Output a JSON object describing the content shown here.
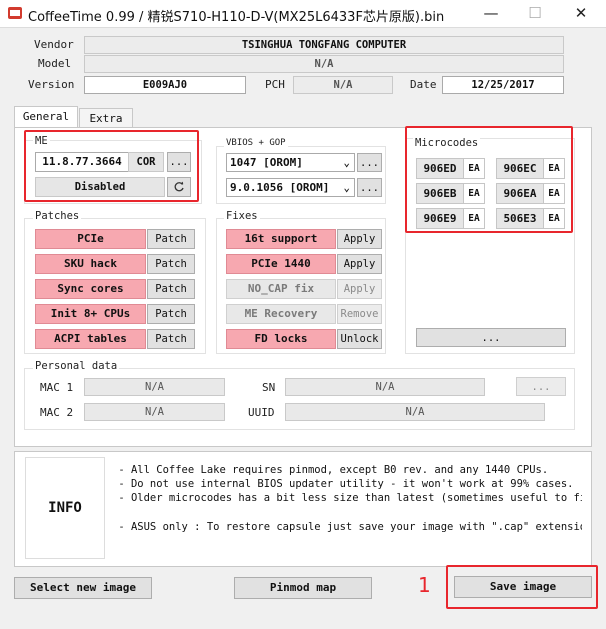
{
  "window": {
    "title": "CoffeeTime 0.99  /  精锐S710-H110-D-V(MX25L6433F芯片原版).bin",
    "minimize": "—",
    "maximize": "☐",
    "close": "✕"
  },
  "header": {
    "vendor_label": "Vendor",
    "vendor_value": "TSINGHUA TONGFANG COMPUTER",
    "model_label": "Model",
    "model_value": "N/A",
    "version_label": "Version",
    "version_value": "E009AJ0",
    "pch_label": "PCH",
    "pch_value": "N/A",
    "date_label": "Date",
    "date_value": "12/25/2017"
  },
  "tabs": [
    "General",
    "Extra"
  ],
  "me": {
    "title": "ME",
    "version": "11.8.77.3664",
    "type": "COR",
    "more": "...",
    "state": "Disabled",
    "refresh_icon": "refresh-icon"
  },
  "vbios": {
    "title": "VBIOS + GOP",
    "vbios_value": "1047 [OROM]",
    "gop_value": "9.0.1056 [OROM]",
    "more": "..."
  },
  "microcodes": {
    "title": "Microcodes",
    "items": [
      {
        "code": "906ED",
        "btn": "EA"
      },
      {
        "code": "906EC",
        "btn": "EA"
      },
      {
        "code": "906EB",
        "btn": "EA"
      },
      {
        "code": "906EA",
        "btn": "EA"
      },
      {
        "code": "906E9",
        "btn": "EA"
      },
      {
        "code": "506E3",
        "btn": "EA"
      }
    ],
    "more": "..."
  },
  "patches": {
    "title": "Patches",
    "items": [
      {
        "label": "PCIe",
        "action": "Patch"
      },
      {
        "label": "SKU hack",
        "action": "Patch"
      },
      {
        "label": "Sync cores",
        "action": "Patch"
      },
      {
        "label": "Init 8+ CPUs",
        "action": "Patch"
      },
      {
        "label": "ACPI tables",
        "action": "Patch"
      }
    ]
  },
  "fixes": {
    "title": "Fixes",
    "items": [
      {
        "label": "16t support",
        "action": "Apply",
        "enabled": true
      },
      {
        "label": "PCIe 1440",
        "action": "Apply",
        "enabled": true
      },
      {
        "label": "NO_CAP fix",
        "action": "Apply",
        "enabled": false
      },
      {
        "label": "ME Recovery",
        "action": "Remove",
        "enabled": false
      },
      {
        "label": "FD locks",
        "action": "Unlock",
        "enabled": true
      }
    ]
  },
  "personal": {
    "title": "Personal data",
    "mac1_label": "MAC 1",
    "mac1_value": "N/A",
    "sn_label": "SN",
    "sn_value": "N/A",
    "more": "...",
    "mac2_label": "MAC 2",
    "mac2_value": "N/A",
    "uuid_label": "UUID",
    "uuid_value": "N/A"
  },
  "info": {
    "label": "INFO",
    "text": " - All Coffee Lake requires pinmod, except B0 rev. and any 1440 CPUs.\n - Do not use internal BIOS updater utility - it won't work at 99% cases.\n - Older microcodes has a bit less size than latest (sometimes useful to fit i\n\n - ASUS only : To restore capsule just save your image with \".cap\" extension."
  },
  "bottom": {
    "select_image": "Select new image",
    "pinmod_map": "Pinmod map",
    "save_image": "Save image",
    "annotation": "1"
  },
  "colors": {
    "highlight": "#e8262d",
    "pink": "#f7a8b0"
  }
}
